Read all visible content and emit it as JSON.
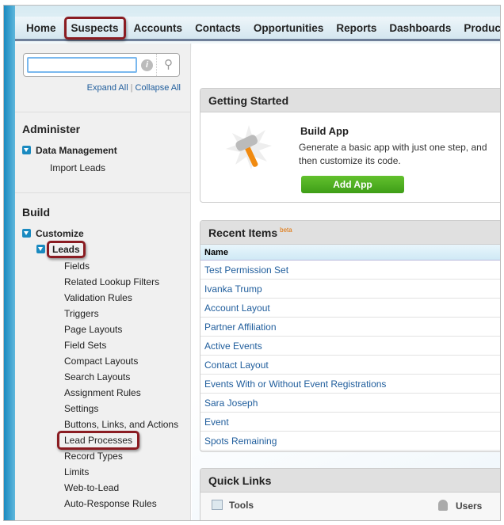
{
  "nav": {
    "tabs": [
      "Home",
      "Suspects",
      "Accounts",
      "Contacts",
      "Opportunities",
      "Reports",
      "Dashboards",
      "Products"
    ]
  },
  "sidebar": {
    "search_value": "",
    "expand_all": "Expand All",
    "collapse_all": "Collapse All",
    "administer": {
      "title": "Administer",
      "data_management": "Data Management",
      "import_leads": "Import Leads"
    },
    "build": {
      "title": "Build",
      "customize": "Customize",
      "leads": "Leads",
      "items": [
        "Fields",
        "Related Lookup Filters",
        "Validation Rules",
        "Triggers",
        "Page Layouts",
        "Field Sets",
        "Compact Layouts",
        "Search Layouts",
        "Assignment Rules",
        "Settings",
        "Buttons, Links, and Actions",
        "Lead Processes",
        "Record Types",
        "Limits",
        "Web-to-Lead",
        "Auto-Response Rules"
      ]
    }
  },
  "getting_started": {
    "title": "Getting Started",
    "heading": "Build App",
    "description": "Generate a basic app with just one step, and then customize its code.",
    "button": "Add App"
  },
  "recent_items": {
    "title": "Recent Items",
    "badge": "beta",
    "column": "Name",
    "rows": [
      "Test Permission Set",
      "Ivanka Trump",
      "Account Layout",
      "Partner Affiliation",
      "Active Events",
      "Contact Layout",
      "Events With or Without Event Registrations",
      "Sara Joseph",
      "Event",
      "Spots Remaining"
    ]
  },
  "quick_links": {
    "title": "Quick Links",
    "tools": "Tools",
    "users": "Users"
  },
  "colors": {
    "accent": "#1a8ac0",
    "highlight": "#8a1c22",
    "button": "#4fae20",
    "link": "#1f5d9c"
  }
}
